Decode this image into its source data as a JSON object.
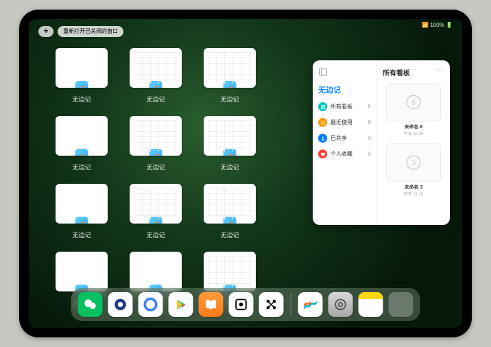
{
  "status": {
    "text": "📶 100% 🔋"
  },
  "topbar": {
    "plus": "+",
    "reopen": "重新打开已关闭的窗口"
  },
  "thumbs": {
    "label": "无边记",
    "items": [
      {
        "variant": "blank"
      },
      {
        "variant": "wide"
      },
      {
        "variant": "wide"
      },
      {
        "variant": "blank"
      },
      {
        "variant": "wide"
      },
      {
        "variant": "wide"
      },
      {
        "variant": "blank"
      },
      {
        "variant": "wide"
      },
      {
        "variant": "wide"
      },
      {
        "variant": "blank"
      },
      {
        "variant": "blank"
      },
      {
        "variant": "wide"
      }
    ]
  },
  "panel": {
    "left_title": "无边记",
    "right_title": "所有看板",
    "menu": [
      {
        "icon": "all",
        "label": "所有看板",
        "count": "8"
      },
      {
        "icon": "recent",
        "label": "最近使用",
        "count": "8"
      },
      {
        "icon": "shared",
        "label": "已共享",
        "count": "0"
      },
      {
        "icon": "fav",
        "label": "个人收藏",
        "count": "0"
      }
    ],
    "boards": [
      {
        "title": "未命名 6",
        "sub": "昨天 11:28",
        "glyph": "6"
      },
      {
        "title": "未命名 3",
        "sub": "昨天 11:25",
        "glyph": "3"
      }
    ]
  },
  "dock": {
    "apps_left": [
      {
        "name": "wechat-app",
        "cls": "app-wechat"
      },
      {
        "name": "browser-circle-app",
        "cls": "app-browser1"
      },
      {
        "name": "browser-q-app",
        "cls": "app-browser2"
      },
      {
        "name": "play-store-app",
        "cls": "app-play"
      },
      {
        "name": "books-app",
        "cls": "app-books"
      },
      {
        "name": "dice-app",
        "cls": "app-dice"
      },
      {
        "name": "connect-app",
        "cls": "app-grid"
      }
    ],
    "apps_right": [
      {
        "name": "freeform-app",
        "cls": "app-freeform"
      },
      {
        "name": "settings-app",
        "cls": "app-settings"
      },
      {
        "name": "notes-app",
        "cls": "app-notes"
      },
      {
        "name": "app-folder",
        "cls": "app-folder"
      }
    ]
  }
}
